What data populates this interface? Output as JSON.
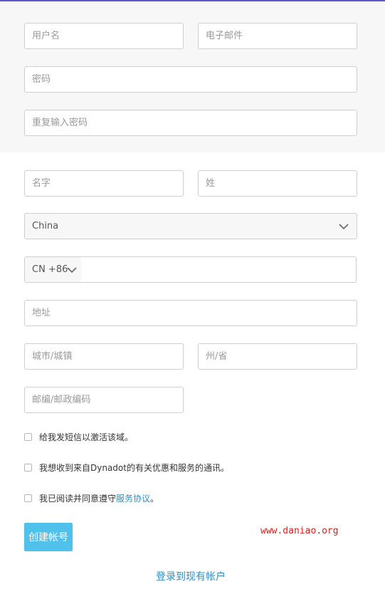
{
  "account": {
    "username_placeholder": "用户名",
    "email_placeholder": "电子邮件",
    "password_placeholder": "密码",
    "repeat_password_placeholder": "重复输入密码"
  },
  "profile": {
    "first_name_placeholder": "名字",
    "last_name_placeholder": "姓",
    "country_value": "China",
    "phone_prefix_value": "CN +86",
    "phone_value": "",
    "address_placeholder": "地址",
    "city_placeholder": "城市/城镇",
    "state_placeholder": "州/省",
    "zip_placeholder": "邮编/邮政编码"
  },
  "options": {
    "sms_activation": "给我发短信以激活该域。",
    "promotions": "我想收到来自Dynadot的有关优惠和服务的通讯。",
    "agree_prefix": "我已阅读并同意遵守",
    "agree_link": "服务协议",
    "agree_suffix": "。"
  },
  "actions": {
    "create_account_label": "创建帐号",
    "login_link": "登录到现有帐户"
  },
  "watermark": "www.daniao.org",
  "colors": {
    "accent_top_bar": "#5a55c9",
    "button": "#4fc1ea",
    "link": "#2b8fd0",
    "watermark": "#e02020"
  }
}
